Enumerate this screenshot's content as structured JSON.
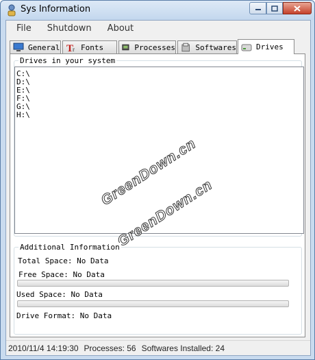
{
  "window": {
    "title": "Sys Information"
  },
  "menu": [
    "File",
    "Shutdown",
    "About"
  ],
  "tabs": [
    {
      "label": "General",
      "icon": "general-icon"
    },
    {
      "label": "Fonts",
      "icon": "fonts-icon"
    },
    {
      "label": "Processes",
      "icon": "processes-icon"
    },
    {
      "label": "Softwares",
      "icon": "softwares-icon"
    },
    {
      "label": "Drives",
      "icon": "drive-icon",
      "active": true
    }
  ],
  "drives": {
    "group_label": "Drives in your system",
    "items": [
      "C:\\",
      "D:\\",
      "E:\\",
      "F:\\",
      "G:\\",
      "H:\\"
    ]
  },
  "additional": {
    "group_label": "Additional Information",
    "total_space": "Total Space: No Data",
    "free_space": "Free Space: No Data",
    "used_space": "Used Space: No Data",
    "drive_format": "Drive Format: No Data"
  },
  "status": {
    "datetime": "2010/11/4 14:19:30",
    "processes": "Processes: 56",
    "softwares": "Softwares Installed: 24"
  },
  "watermark": "GreenDown.cn"
}
